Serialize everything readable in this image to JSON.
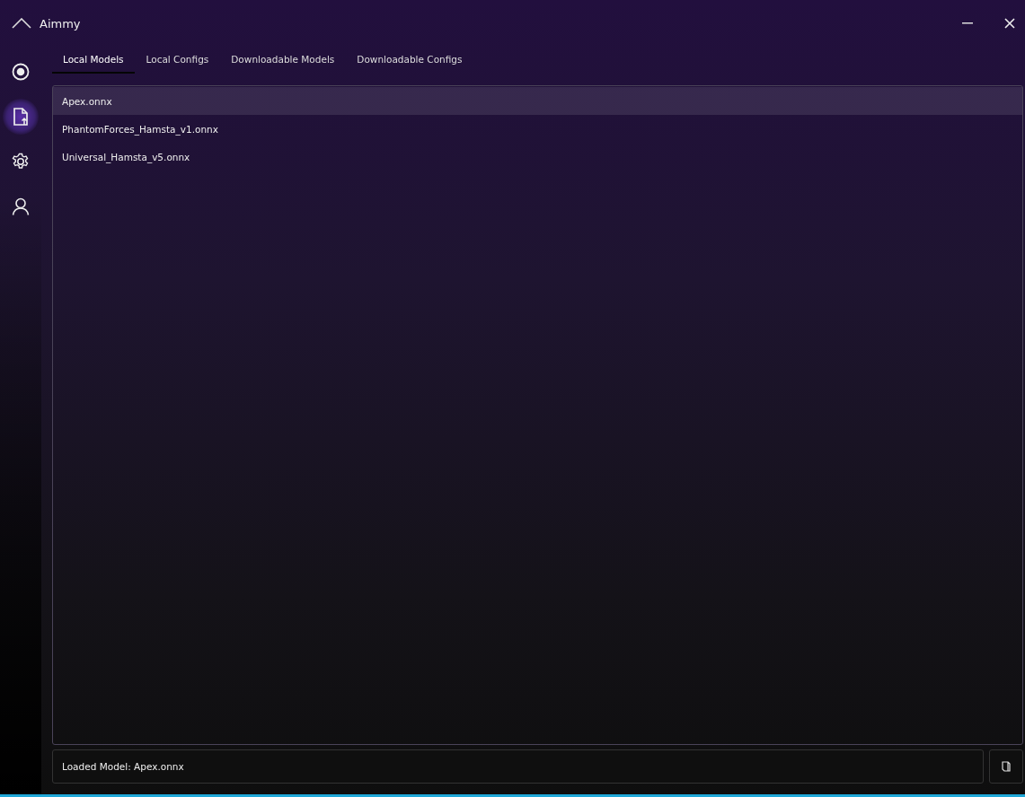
{
  "window": {
    "title": "Aimmy"
  },
  "nav": [
    {
      "kind": "target",
      "selected": false
    },
    {
      "kind": "file",
      "selected": true
    },
    {
      "kind": "gear",
      "selected": false
    },
    {
      "kind": "user",
      "selected": false
    }
  ],
  "tabs": [
    {
      "label": "Local Models",
      "selected": true
    },
    {
      "label": "Local Configs",
      "selected": false
    },
    {
      "label": "Downloadable Models",
      "selected": false
    },
    {
      "label": "Downloadable Configs",
      "selected": false
    }
  ],
  "models": [
    {
      "name": "Apex.onnx",
      "selected": true
    },
    {
      "name": "PhantomForces_Hamsta_v1.onnx",
      "selected": false
    },
    {
      "name": "Universal_Hamsta_v5.onnx",
      "selected": false
    }
  ],
  "status_bar": {
    "text": "Loaded Model: Apex.onnx"
  }
}
